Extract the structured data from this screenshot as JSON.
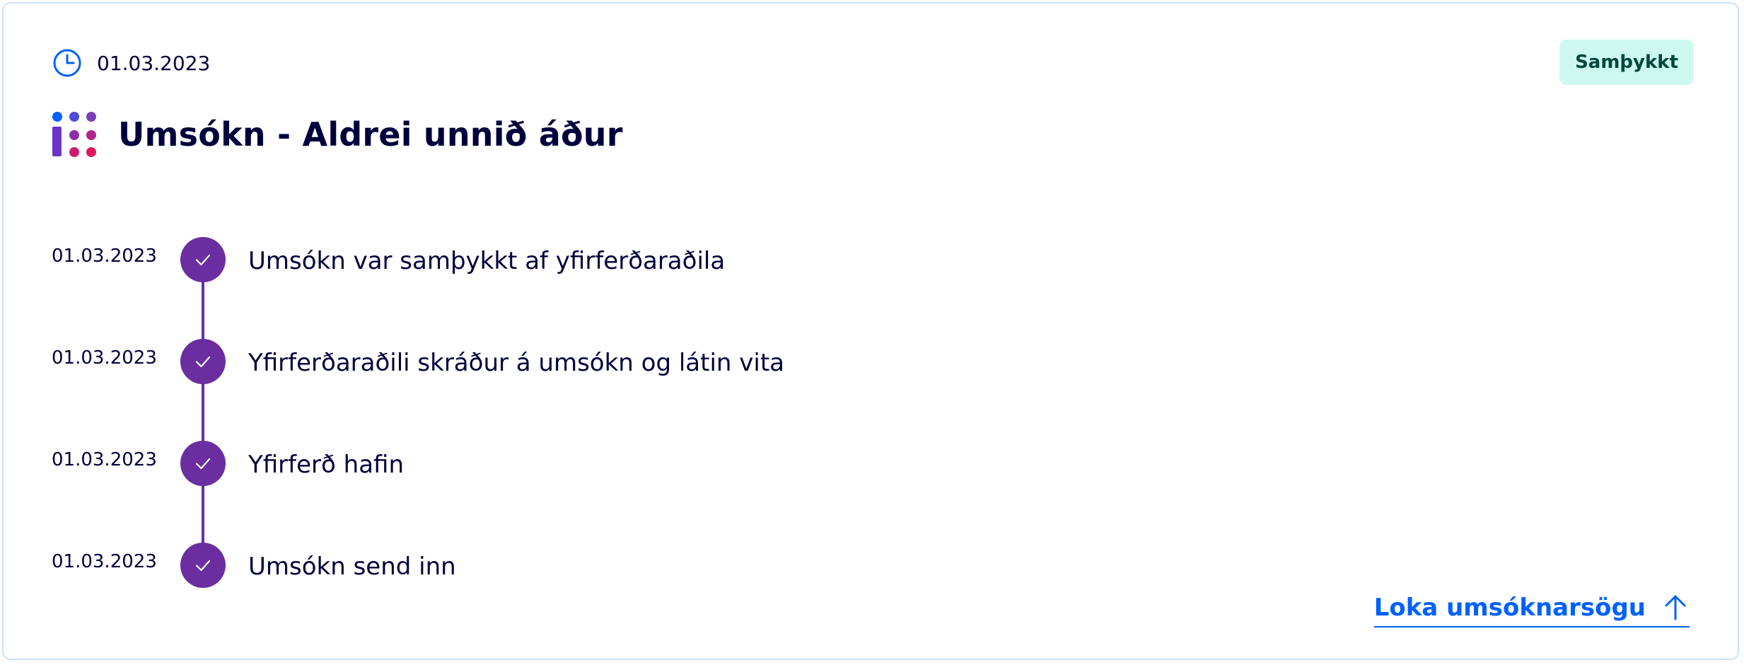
{
  "header": {
    "date": "01.03.2023",
    "status_badge": "Samþykkt",
    "title": "Umsókn - Aldrei unnið áður",
    "icons": {
      "date": "clock-icon",
      "logo": "island-logo-icon"
    }
  },
  "timeline": [
    {
      "date": "01.03.2023",
      "text": "Umsókn var samþykkt af yfirferðaraðila",
      "icon": "check-icon"
    },
    {
      "date": "01.03.2023",
      "text": "Yfirferðaraðili skráður á umsókn og látin vita",
      "icon": "check-icon"
    },
    {
      "date": "01.03.2023",
      "text": "Yfirferð hafin",
      "icon": "check-icon"
    },
    {
      "date": "01.03.2023",
      "text": "Umsókn send inn",
      "icon": "check-icon"
    }
  ],
  "footer": {
    "close_history_label": "Loka umsóknarsögu",
    "close_icon": "arrow-up-icon"
  },
  "colors": {
    "primary_text": "#00003c",
    "timeline_accent": "#6a2ea0",
    "link_blue": "#0061ff",
    "badge_bg": "#ccf8ef",
    "badge_text": "#00483b",
    "card_border": "#ccdfff"
  }
}
